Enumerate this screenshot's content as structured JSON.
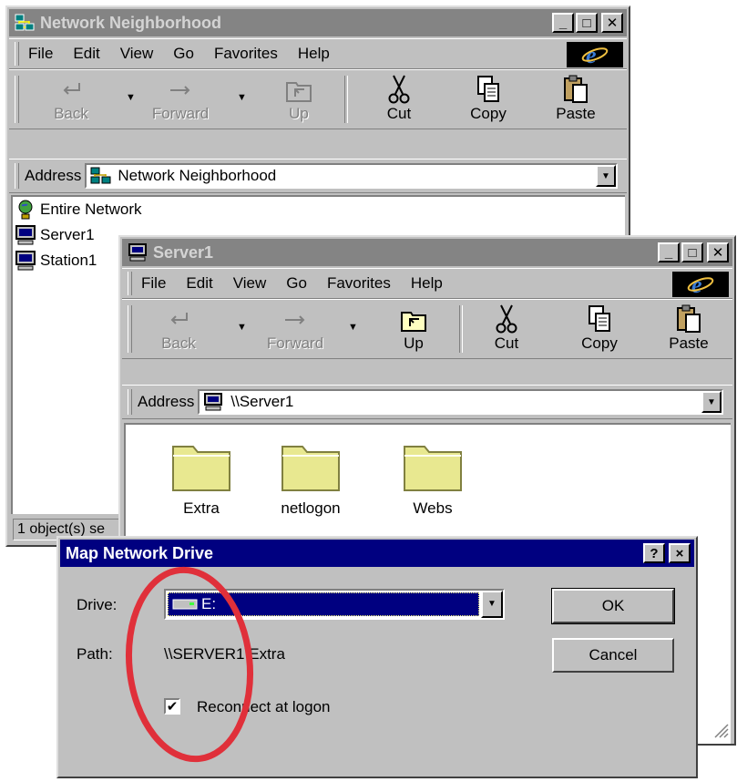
{
  "win1": {
    "title": "Network Neighborhood",
    "menu": [
      "File",
      "Edit",
      "View",
      "Go",
      "Favorites",
      "Help"
    ],
    "toolbar": {
      "back": "Back",
      "forward": "Forward",
      "up": "Up",
      "cut": "Cut",
      "copy": "Copy",
      "paste": "Paste"
    },
    "address_label": "Address",
    "address_value": "Network Neighborhood",
    "items": [
      "Entire Network",
      "Server1",
      "Station1"
    ],
    "status": "1 object(s) se"
  },
  "win2": {
    "title": "Server1",
    "menu": [
      "File",
      "Edit",
      "View",
      "Go",
      "Favorites",
      "Help"
    ],
    "toolbar": {
      "back": "Back",
      "forward": "Forward",
      "up": "Up",
      "cut": "Cut",
      "copy": "Copy",
      "paste": "Paste"
    },
    "address_label": "Address",
    "address_value": "\\\\Server1",
    "folders": [
      "Extra",
      "netlogon",
      "Webs"
    ]
  },
  "dialog": {
    "title": "Map Network Drive",
    "drive_label": "Drive:",
    "drive_value": "E:",
    "path_label": "Path:",
    "path_value": "\\\\SERVER1\\Extra",
    "reconnect_label": "Reconnect at logon",
    "reconnect_checked": true,
    "ok_label": "OK",
    "cancel_label": "Cancel",
    "help_btn": "?",
    "close_btn": "×"
  },
  "highlight": {
    "color": "#e0303a",
    "shape": "ellipse"
  },
  "colors": {
    "face": "#c0c0c0",
    "active_title": "#000080",
    "inactive_title": "#848484"
  }
}
